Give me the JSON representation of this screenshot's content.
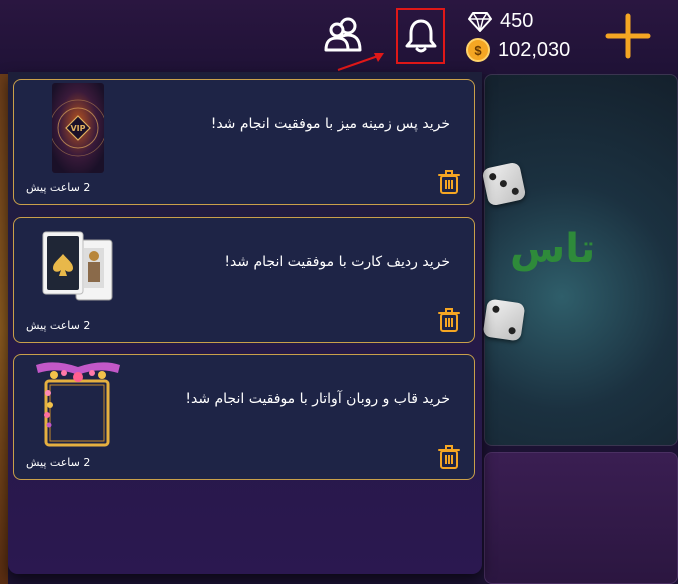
{
  "header": {
    "gems": "450",
    "coins": "102,030",
    "coin_symbol": "$"
  },
  "background": {
    "game_title": "تاس"
  },
  "notifications": [
    {
      "title": "خرید پس زمینه میز با موفقیت انجام شد!",
      "time": "2 ساعت پیش",
      "thumb_label": "VIP"
    },
    {
      "title": "خرید ردیف کارت با موفقیت انجام شد!",
      "time": "2 ساعت پیش"
    },
    {
      "title": "خرید قاب و روبان آواتار با موفقیت انجام شد!",
      "time": "2 ساعت پیش"
    }
  ],
  "colors": {
    "accent": "#f5a623",
    "highlight_box": "#e01818",
    "card_border": "#c9a04a",
    "card_bg": "#1e2446"
  }
}
